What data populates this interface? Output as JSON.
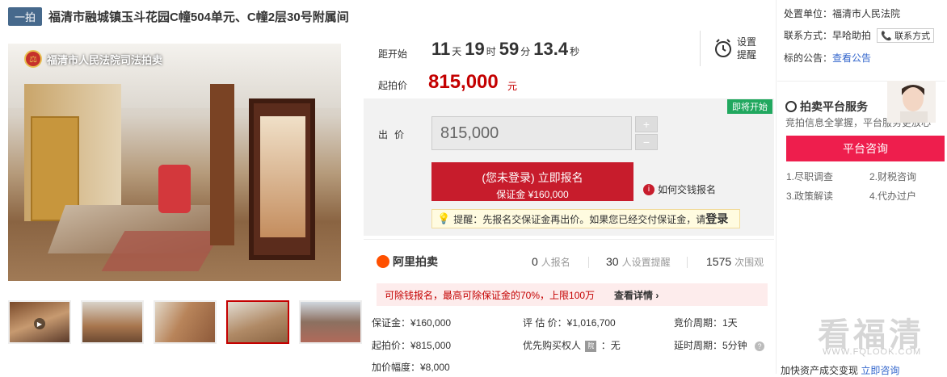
{
  "header": {
    "tag": "一拍",
    "title": "福清市融城镇玉斗花园C幢504单元、C幢2层30号附属间"
  },
  "image": {
    "court_watermark": "福清市人民法院司法拍卖",
    "emblem_text": "⚖"
  },
  "timer": {
    "label": "距开始",
    "days": "11",
    "days_unit": "天",
    "hours": "19",
    "hours_unit": "时",
    "minutes": "59",
    "minutes_unit": "分",
    "seconds": "13.4",
    "seconds_unit": "秒",
    "remind_label": "设置提醒"
  },
  "start_price": {
    "label": "起拍价",
    "value": "815,000",
    "unit": "元"
  },
  "bid": {
    "soon_badge": "即将开始",
    "label": "出价",
    "input_value": "815,000",
    "plus": "+",
    "minus": "−",
    "signup_main": "(您未登录) 立即报名",
    "signup_sub": "保证金 ¥160,000",
    "howto": "如何交钱报名",
    "tip_prefix": "提醒：先报名交保证金再出价。如果您已经交付保证金，请",
    "tip_login": "登录"
  },
  "stats": {
    "brand": "阿里拍卖",
    "signups": "0",
    "signups_label": "人报名",
    "reminders": "30",
    "reminders_label": "人设置提醒",
    "views": "1575",
    "views_label": "次围观"
  },
  "loan": {
    "text": "可除钱报名，最高可除保证金的70%，上限100万",
    "more": "查看详情 ›"
  },
  "details": {
    "deposit": "保证金：¥160,000",
    "appraisal": "评 估 价：¥1,016,700",
    "cycle": "竞价周期：1天",
    "start": "起拍价：¥815,000",
    "priority_prefix": "优先购买权人",
    "priority_seal": "院",
    "priority_suffix": "：无",
    "delay": "延时周期：5分钟",
    "increment": "加价幅度：¥8,000"
  },
  "sidebar": {
    "org_label": "处置单位：",
    "org_value": "福清市人民法院",
    "contact_label": "联系方式：",
    "contact_value": "早哈助拍",
    "contact_btn": "📞 联系方式",
    "notice_label": "标的公告：",
    "notice_link": "查看公告",
    "svc_title": "拍卖平台服务",
    "svc_sub": "竞拍信息全掌握，平台服务更放心",
    "consult_btn": "平台咨询",
    "items": [
      "1.尽职调查",
      "2.财税咨询",
      "3.政策解读",
      "4.代办过户"
    ],
    "bottom_text": "加快资产成交变现",
    "bottom_link": "立即咨询",
    "watermark": "看福清",
    "watermark_url": "WWW.FQLOOK.COM"
  }
}
